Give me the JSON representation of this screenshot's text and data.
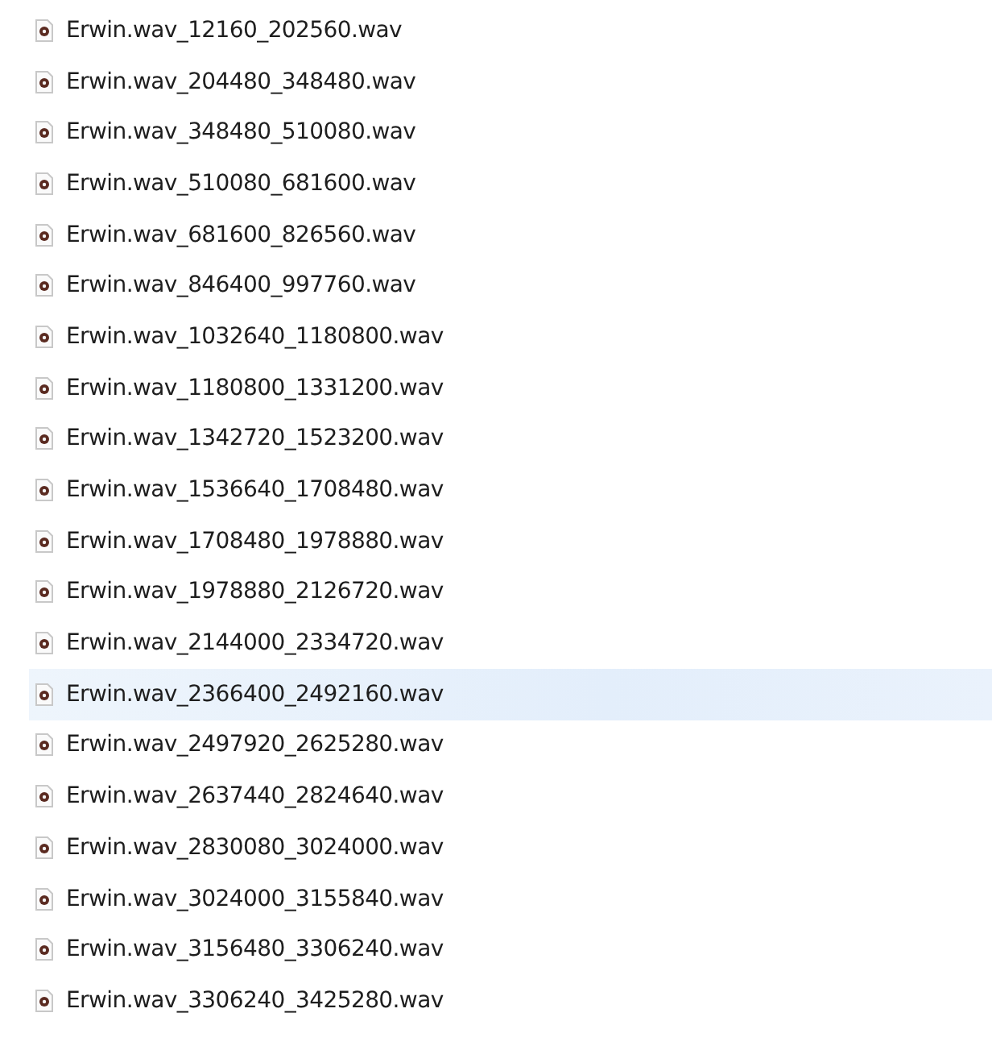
{
  "files": [
    {
      "name": "Erwin.wav_12160_202560.wav",
      "hovered": false
    },
    {
      "name": "Erwin.wav_204480_348480.wav",
      "hovered": false
    },
    {
      "name": "Erwin.wav_348480_510080.wav",
      "hovered": false
    },
    {
      "name": "Erwin.wav_510080_681600.wav",
      "hovered": false
    },
    {
      "name": "Erwin.wav_681600_826560.wav",
      "hovered": false
    },
    {
      "name": "Erwin.wav_846400_997760.wav",
      "hovered": false
    },
    {
      "name": "Erwin.wav_1032640_1180800.wav",
      "hovered": false
    },
    {
      "name": "Erwin.wav_1180800_1331200.wav",
      "hovered": false
    },
    {
      "name": "Erwin.wav_1342720_1523200.wav",
      "hovered": false
    },
    {
      "name": "Erwin.wav_1536640_1708480.wav",
      "hovered": false
    },
    {
      "name": "Erwin.wav_1708480_1978880.wav",
      "hovered": false
    },
    {
      "name": "Erwin.wav_1978880_2126720.wav",
      "hovered": false
    },
    {
      "name": "Erwin.wav_2144000_2334720.wav",
      "hovered": false
    },
    {
      "name": "Erwin.wav_2366400_2492160.wav",
      "hovered": true
    },
    {
      "name": "Erwin.wav_2497920_2625280.wav",
      "hovered": false
    },
    {
      "name": "Erwin.wav_2637440_2824640.wav",
      "hovered": false
    },
    {
      "name": "Erwin.wav_2830080_3024000.wav",
      "hovered": false
    },
    {
      "name": "Erwin.wav_3024000_3155840.wav",
      "hovered": false
    },
    {
      "name": "Erwin.wav_3156480_3306240.wav",
      "hovered": false
    },
    {
      "name": "Erwin.wav_3306240_3425280.wav",
      "hovered": false
    }
  ]
}
